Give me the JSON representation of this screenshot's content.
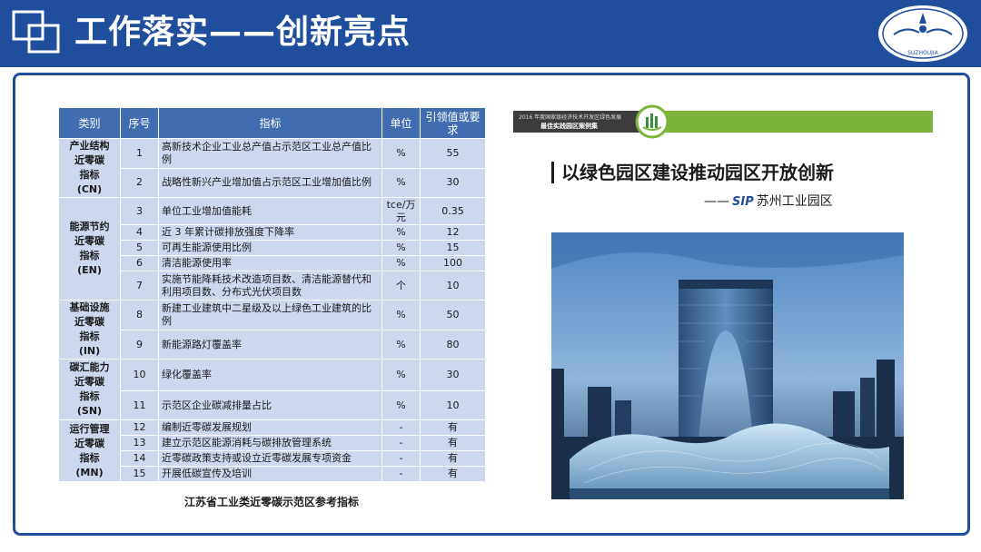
{
  "header": {
    "title": "工作落实——创新亮点",
    "badge_text": "SUZHOUJIA"
  },
  "table": {
    "columns": [
      "类别",
      "序号",
      "指标",
      "单位",
      "引领值或要求"
    ],
    "groups": [
      {
        "category": "产业结构近零碳指标(CN)",
        "category_lines": [
          "产业结构",
          "近零碳",
          "指标",
          "(CN)"
        ],
        "rows": [
          {
            "no": "1",
            "indicator": "高新技术企业工业总产值占示范区工业总产值比例",
            "unit": "%",
            "value": "55"
          },
          {
            "no": "2",
            "indicator": "战略性新兴产业增加值占示范区工业增加值比例",
            "unit": "%",
            "value": "30"
          }
        ]
      },
      {
        "category": "能源节约近零碳指标(EN)",
        "category_lines": [
          "能源节约",
          "近零碳",
          "指标",
          "(EN)"
        ],
        "rows": [
          {
            "no": "3",
            "indicator": "单位工业增加值能耗",
            "unit": "tce/万元",
            "value": "0.35"
          },
          {
            "no": "4",
            "indicator": "近 3 年累计碳排放强度下降率",
            "unit": "%",
            "value": "12"
          },
          {
            "no": "5",
            "indicator": "可再生能源使用比例",
            "unit": "%",
            "value": "15"
          },
          {
            "no": "6",
            "indicator": "清洁能源使用率",
            "unit": "%",
            "value": "100"
          },
          {
            "no": "7",
            "indicator": "实施节能降耗技术改造项目数、清洁能源替代和利用项目数、分布式光伏项目数",
            "unit": "个",
            "value": "10"
          }
        ]
      },
      {
        "category": "基础设施近零碳指标(IN)",
        "category_lines": [
          "基础设施",
          "近零碳",
          "指标",
          "(IN)"
        ],
        "rows": [
          {
            "no": "8",
            "indicator": "新建工业建筑中二星级及以上绿色工业建筑的比例",
            "unit": "%",
            "value": "50"
          },
          {
            "no": "9",
            "indicator": "新能源路灯覆盖率",
            "unit": "%",
            "value": "80"
          }
        ]
      },
      {
        "category": "碳汇能力近零碳指标(SN)",
        "category_lines": [
          "碳汇能力",
          "近零碳",
          "指标",
          "(SN)"
        ],
        "rows": [
          {
            "no": "10",
            "indicator": "绿化覆盖率",
            "unit": "%",
            "value": "30"
          },
          {
            "no": "11",
            "indicator": "示范区企业碳减排量占比",
            "unit": "%",
            "value": "10"
          }
        ]
      },
      {
        "category": "运行管理近零碳指标(MN)",
        "category_lines": [
          "运行管理",
          "近零碳",
          "指标",
          "(MN)"
        ],
        "rows": [
          {
            "no": "12",
            "indicator": "编制近零碳发展规划",
            "unit": "-",
            "value": "有"
          },
          {
            "no": "13",
            "indicator": "建立示范区能源消耗与碳排放管理系统",
            "unit": "-",
            "value": "有"
          },
          {
            "no": "14",
            "indicator": "近零碳政策支持或设立近零碳发展专项资金",
            "unit": "-",
            "value": "有"
          },
          {
            "no": "15",
            "indicator": "开展低碳宣传及培训",
            "unit": "-",
            "value": "有"
          }
        ]
      }
    ],
    "caption": "江苏省工业类近零碳示范区参考指标"
  },
  "promo": {
    "report_line1": "2016 年度国家级经济技术开发区绿色发展",
    "report_line2": "最佳实践园区案例集",
    "title": "以绿色园区建设推动园区开放创新",
    "sub_dash": "——",
    "sip_logo": "SIP",
    "sub_text": "苏州工业园区"
  },
  "colors": {
    "header": "#1f4e9c",
    "table_header": "#3f6db0",
    "table_cell": "#cdd8ee",
    "green_bar": "#7db53a"
  }
}
